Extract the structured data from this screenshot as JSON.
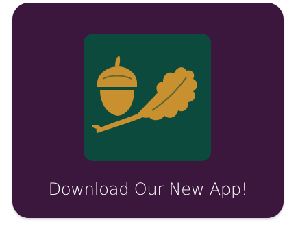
{
  "promo": {
    "caption": "Download Our New App!",
    "logo_icon": "acorn-oak-leaf-icon"
  },
  "colors": {
    "card_background": "#3c173d",
    "tile_background": "#0c4a3d",
    "logo_gold": "#c8902e",
    "caption_text": "#ffffff"
  }
}
